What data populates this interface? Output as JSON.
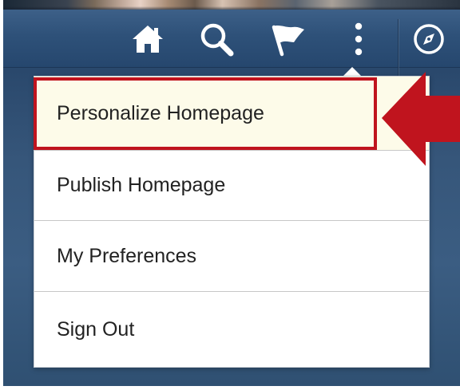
{
  "header": {
    "icons": {
      "home": "home-icon",
      "search": "search-icon",
      "flag": "flag-icon",
      "actions": "more-vertical-icon",
      "navbar": "compass-icon"
    }
  },
  "menu": {
    "items": [
      {
        "label": "Personalize Homepage",
        "highlighted": true
      },
      {
        "label": "Publish Homepage"
      },
      {
        "label": "My Preferences"
      },
      {
        "label": "Sign Out"
      }
    ]
  },
  "colors": {
    "header": "#2e5179",
    "highlight": "#c0141e",
    "menu_text": "#222222",
    "highlighted_item_bg": "#fdfbe9"
  }
}
